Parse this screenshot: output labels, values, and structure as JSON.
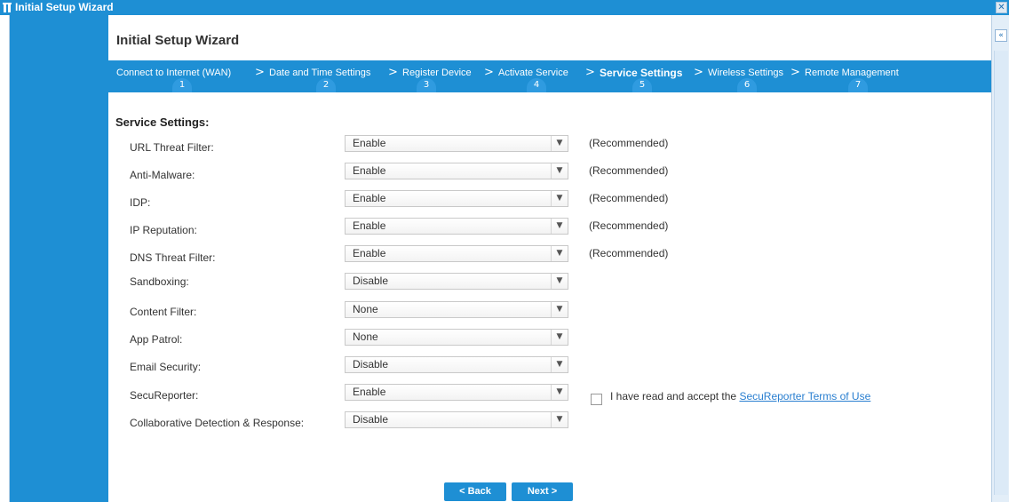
{
  "window": {
    "title": "Initial Setup Wizard"
  },
  "wizard": {
    "title": "Initial Setup Wizard"
  },
  "steps": [
    {
      "label": "Connect to Internet (WAN)",
      "number": "1"
    },
    {
      "label": "Date and Time Settings",
      "number": "2"
    },
    {
      "label": "Register Device",
      "number": "3"
    },
    {
      "label": "Activate Service",
      "number": "4"
    },
    {
      "label": "Service Settings",
      "number": "5",
      "active": true
    },
    {
      "label": "Wireless Settings",
      "number": "6"
    },
    {
      "label": "Remote Management",
      "number": "7"
    }
  ],
  "step_separator": ">",
  "section_title": "Service Settings:",
  "settings": [
    {
      "label": "URL Threat Filter:",
      "value": "Enable",
      "note": "(Recommended)"
    },
    {
      "label": "Anti-Malware:",
      "value": "Enable",
      "note": "(Recommended)"
    },
    {
      "label": "IDP:",
      "value": "Enable",
      "note": "(Recommended)"
    },
    {
      "label": "IP Reputation:",
      "value": "Enable",
      "note": "(Recommended)"
    },
    {
      "label": "DNS Threat Filter:",
      "value": "Enable",
      "note": "(Recommended)"
    },
    {
      "label": "Sandboxing:",
      "value": "Disable",
      "note": ""
    },
    {
      "label": "Content Filter:",
      "value": "None",
      "note": ""
    },
    {
      "label": "App Patrol:",
      "value": "None",
      "note": ""
    },
    {
      "label": "Email Security:",
      "value": "Disable",
      "note": ""
    },
    {
      "label": "SecuReporter:",
      "value": "Enable",
      "note": ""
    },
    {
      "label": "Collaborative Detection & Response:",
      "value": "Disable",
      "note": ""
    }
  ],
  "secureporter_terms": {
    "text": "I have read and accept the ",
    "link": "SecuReporter Terms of Use",
    "checked": false
  },
  "buttons": {
    "back": "< Back",
    "next": "Next >"
  },
  "colors": {
    "accent": "#1e8fd4",
    "link": "#2a7fd0"
  }
}
